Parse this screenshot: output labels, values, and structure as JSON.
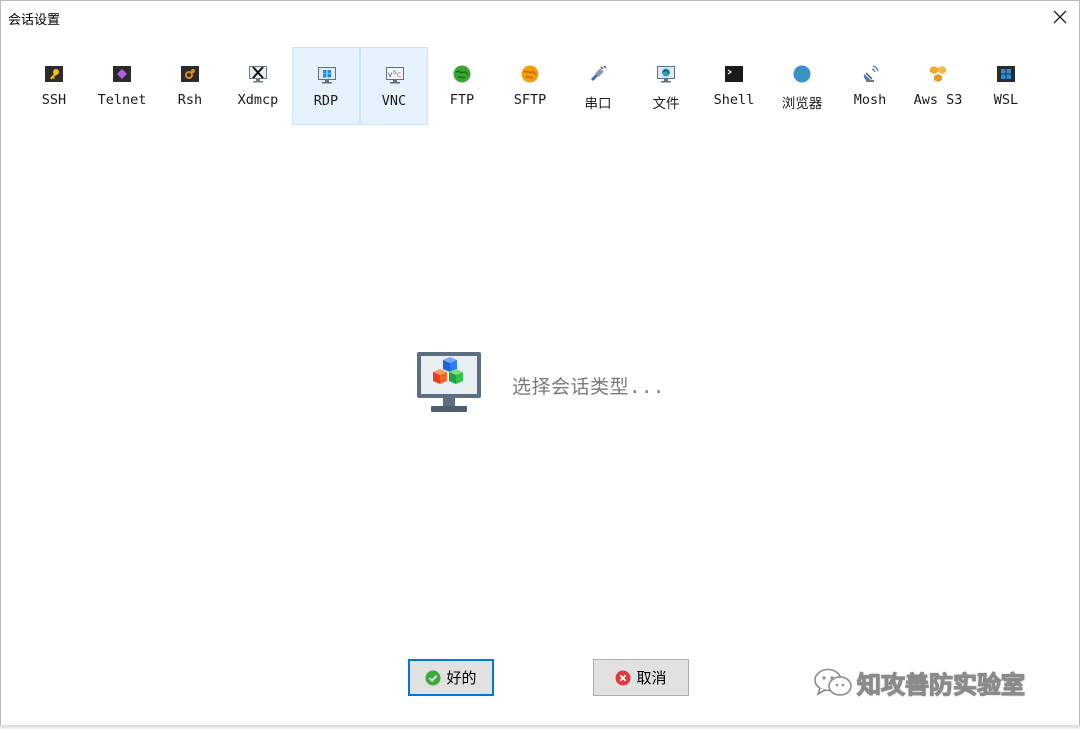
{
  "window": {
    "title": "会话设置"
  },
  "session_types": [
    {
      "label": "SSH",
      "icon": "ssh-icon",
      "highlighted": false
    },
    {
      "label": "Telnet",
      "icon": "telnet-icon",
      "highlighted": false
    },
    {
      "label": "Rsh",
      "icon": "rsh-icon",
      "highlighted": false
    },
    {
      "label": "Xdmcp",
      "icon": "xdmcp-icon",
      "highlighted": false
    },
    {
      "label": "RDP",
      "icon": "rdp-icon",
      "highlighted": true
    },
    {
      "label": "VNC",
      "icon": "vnc-icon",
      "highlighted": true
    },
    {
      "label": "FTP",
      "icon": "ftp-icon",
      "highlighted": false
    },
    {
      "label": "SFTP",
      "icon": "sftp-icon",
      "highlighted": false
    },
    {
      "label": "串口",
      "icon": "serial-icon",
      "highlighted": false
    },
    {
      "label": "文件",
      "icon": "file-icon",
      "highlighted": false
    },
    {
      "label": "Shell",
      "icon": "shell-icon",
      "highlighted": false
    },
    {
      "label": "浏览器",
      "icon": "browser-icon",
      "highlighted": false
    },
    {
      "label": "Mosh",
      "icon": "mosh-icon",
      "highlighted": false
    },
    {
      "label": "Aws S3",
      "icon": "aws-s3-icon",
      "highlighted": false
    },
    {
      "label": "WSL",
      "icon": "wsl-icon",
      "highlighted": false
    }
  ],
  "placeholder": {
    "text": "选择会话类型...",
    "icon": "monitor-cubes-icon"
  },
  "buttons": {
    "ok": {
      "label": "好的",
      "icon": "check-circle-icon"
    },
    "cancel": {
      "label": "取消",
      "icon": "x-circle-icon"
    }
  },
  "watermark": {
    "text": "知攻善防实验室",
    "icon": "wechat-icon"
  },
  "colors": {
    "highlight_bg": "#e5f1fb",
    "highlight_border": "#cce4f7",
    "ok_border": "#0078d7",
    "button_bg": "#e1e1e1",
    "placeholder_text": "#7a7a7a"
  }
}
